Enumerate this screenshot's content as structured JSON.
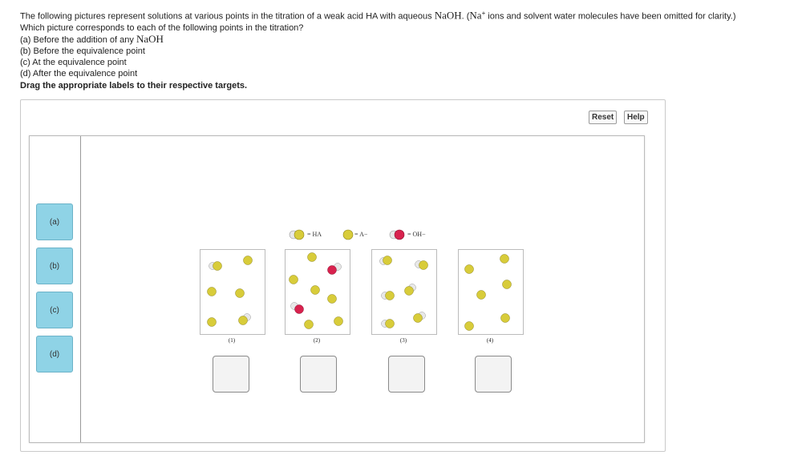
{
  "question": {
    "line1_pre": "The following pictures represent solutions at various points in the titration of a weak acid HA with aqueous ",
    "line1_naoh": "NaOH",
    "line1_mid": ". (",
    "line1_na": "Na",
    "line1_plus": "+",
    "line1_post": " ions and solvent water molecules have been omitted for clarity.)",
    "line2": "Which picture corresponds to each of the following points in the titration?",
    "a_pre": "(a) Before the addition of any ",
    "a_naoh": "NaOH",
    "b": "(b) Before the equivalence point",
    "c": "(c) At the equivalence point",
    "d": "(d) After the equivalence point"
  },
  "instruction": "Drag the appropriate labels to their respective targets.",
  "buttons": {
    "reset": "Reset",
    "help": "Help"
  },
  "labels": [
    "(a)",
    "(b)",
    "(c)",
    "(d)"
  ],
  "legend": {
    "ha": "= HA",
    "a": "= A−",
    "oh": "= OH−"
  },
  "panels": [
    "(1)",
    "(2)",
    "(3)",
    "(4)"
  ],
  "colors": {
    "label_bg": "#8fd3e6",
    "yellow": "#d8cc3a",
    "white": "#e8e8e8",
    "red": "#d8224e"
  }
}
